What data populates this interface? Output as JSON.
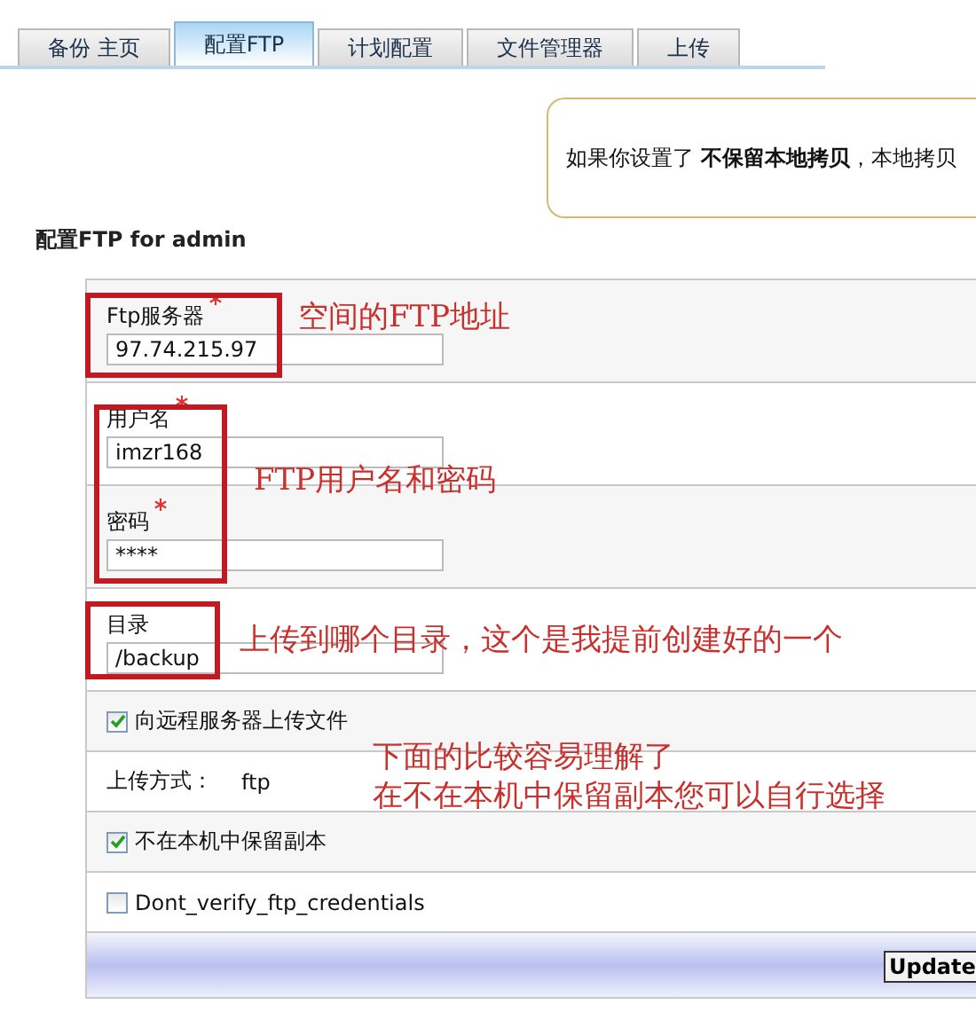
{
  "tabs": [
    {
      "label": "备份 主页",
      "selected": false
    },
    {
      "label": "配置FTP",
      "selected": true
    },
    {
      "label": "计划配置",
      "selected": false
    },
    {
      "label": "文件管理器",
      "selected": false
    },
    {
      "label": "上传",
      "selected": false
    }
  ],
  "notice": {
    "text": "如果你设置了 **不保留本地拷贝**，本地拷贝"
  },
  "heading": "配置FTP for admin",
  "form": {
    "rows": [
      {
        "kind": "field",
        "label": "Ftp服务器",
        "value": "97.74.215.97",
        "required": true
      },
      {
        "kind": "field",
        "label": "用户名",
        "value": "imzr168",
        "required": true
      },
      {
        "kind": "field",
        "label": "密码",
        "value": "****",
        "required": true
      },
      {
        "kind": "field",
        "label": "目录",
        "value": "/backup",
        "required": false
      },
      {
        "kind": "checkbox",
        "label": "向远程服务器上传文件",
        "checked": true
      },
      {
        "kind": "info",
        "label": "上传方式：",
        "value": "ftp"
      },
      {
        "kind": "checkbox",
        "label": "不在本机中保留副本",
        "checked": true
      },
      {
        "kind": "checkbox",
        "label": "Dont_verify_ftp_credentials",
        "checked": false
      }
    ],
    "button": "Update"
  },
  "annotations": [
    {
      "kind": "frame"
    },
    {
      "kind": "frame"
    },
    {
      "kind": "frame"
    },
    {
      "kind": "note",
      "text": "空间的FTP地址"
    },
    {
      "kind": "note",
      "text": "FTP用户名和密码"
    },
    {
      "kind": "note",
      "text": "上传到哪个目录，这个是我提前创建好的一个"
    },
    {
      "kind": "note",
      "text": "下面的比较容易理解了"
    },
    {
      "kind": "note",
      "text": "在不在本机中保留副本您可以自行选择"
    }
  ]
}
